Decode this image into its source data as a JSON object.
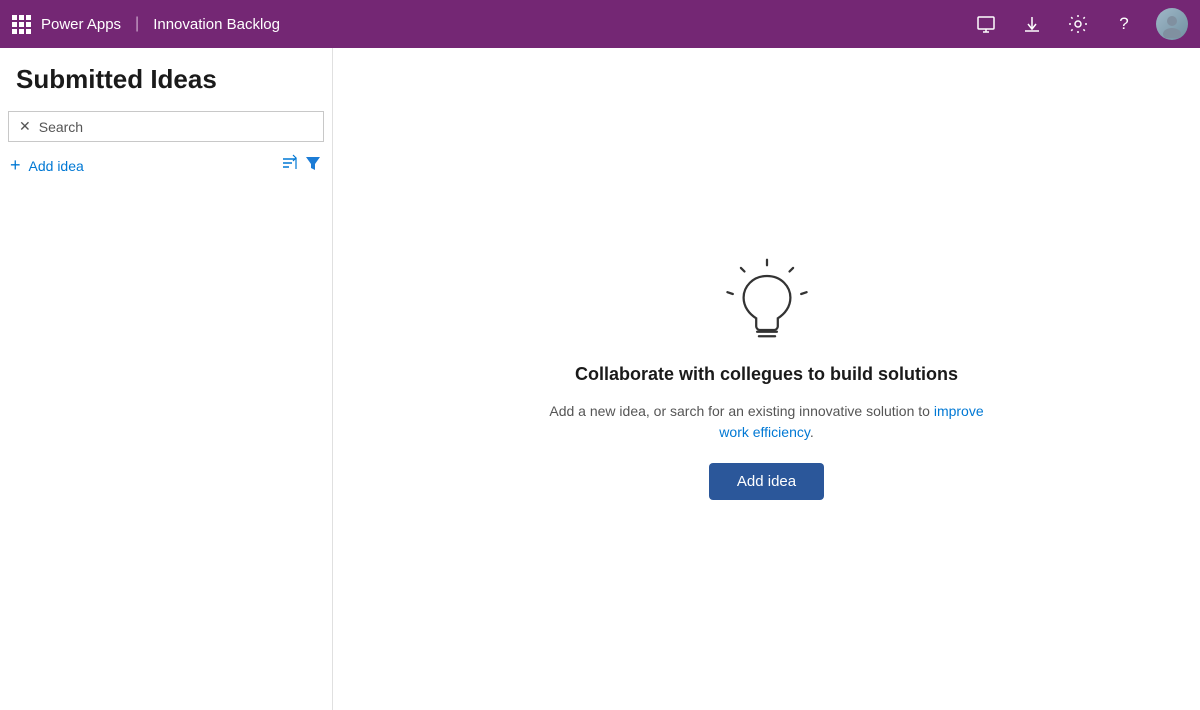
{
  "topbar": {
    "brand": "Power Apps",
    "separator": "|",
    "app_name": "Innovation Backlog",
    "icons": {
      "monitor": "⬜",
      "download": "⬇",
      "settings": "⚙",
      "help": "?"
    }
  },
  "page": {
    "title": "Submitted Ideas"
  },
  "search": {
    "placeholder": "Search",
    "label": "Search"
  },
  "add_idea": {
    "label": "Add idea"
  },
  "empty_state": {
    "title": "Collaborate with collegues to build solutions",
    "description_part1": "Add a new idea, or sarch for an existing innovative solution to ",
    "description_link1": "improve work efficiency",
    "description_part2": ".",
    "button_label": "Add idea"
  }
}
